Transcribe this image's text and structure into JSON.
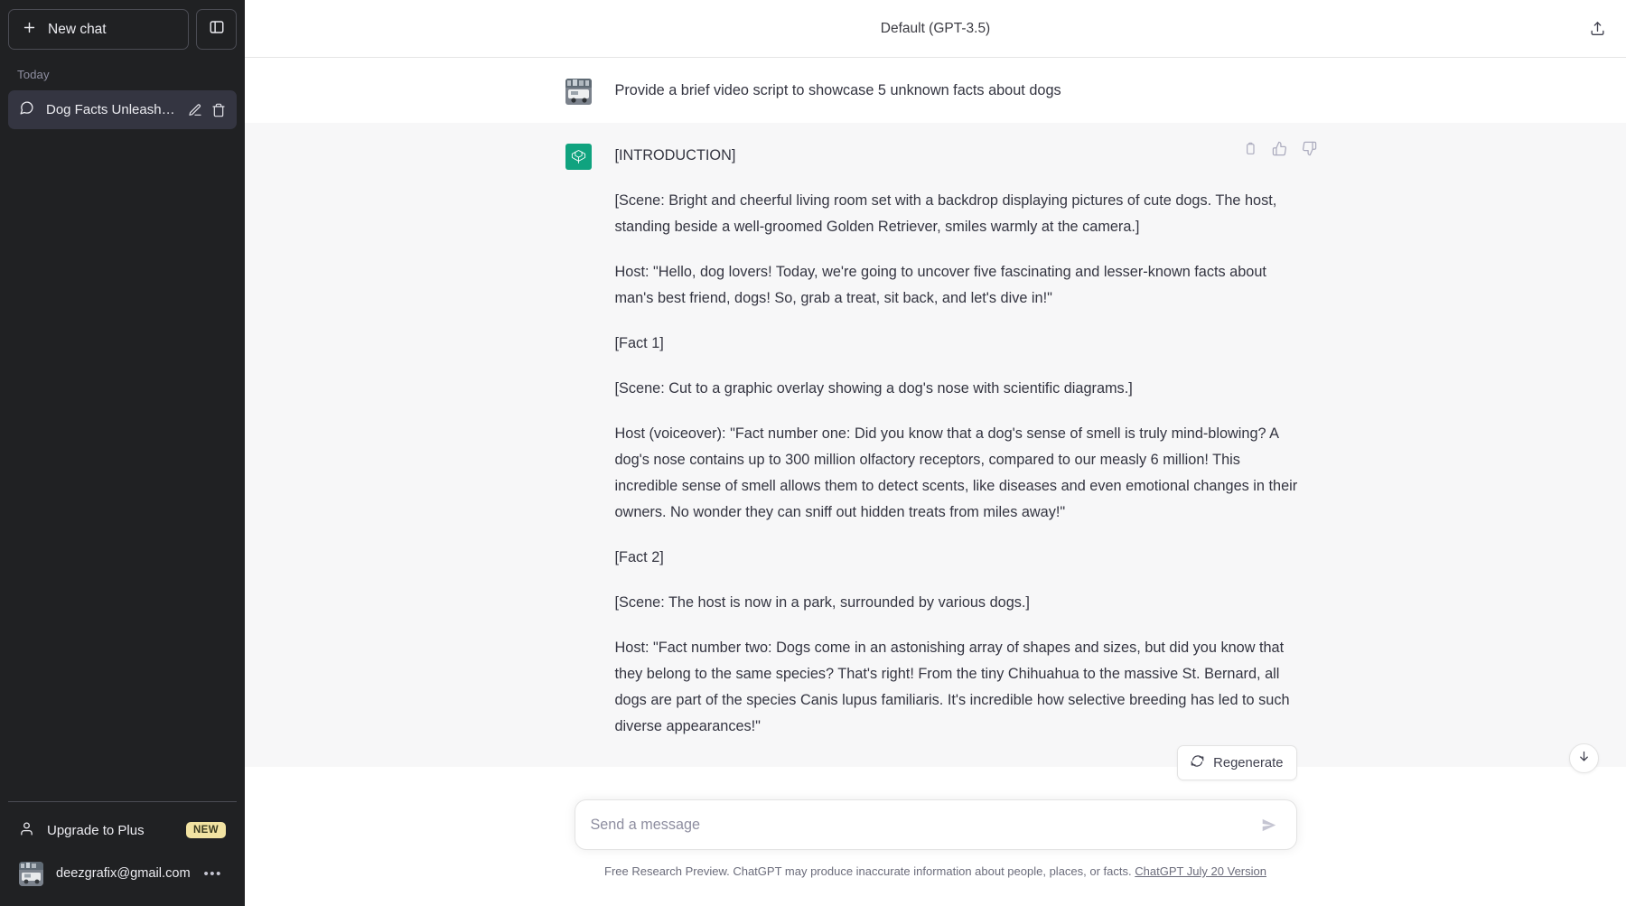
{
  "sidebar": {
    "new_chat_label": "New chat",
    "section_label": "Today",
    "chats": [
      {
        "title": "Dog Facts Unleashed"
      }
    ],
    "upgrade_label": "Upgrade to Plus",
    "upgrade_badge": "NEW",
    "account_email": "deezgrafix@gmail.com",
    "account_menu_dots": "•••",
    "icons": {
      "new_chat": "plus-icon",
      "panel_toggle": "sidebar-toggle-icon",
      "chat": "chat-bubble-icon",
      "edit": "pencil-icon",
      "delete": "trash-icon",
      "person": "person-icon"
    }
  },
  "header": {
    "title": "Default (GPT-3.5)",
    "share_icon": "share-upload-icon"
  },
  "conversation": {
    "user_message": {
      "text": "Provide a brief video script to showcase 5 unknown facts about dogs"
    },
    "assistant_message": {
      "paragraphs": [
        "[INTRODUCTION]",
        "[Scene: Bright and cheerful living room set with a backdrop displaying pictures of cute dogs. The host, standing beside a well-groomed Golden Retriever, smiles warmly at the camera.]",
        "Host: \"Hello, dog lovers! Today, we're going to uncover five fascinating and lesser-known facts about man's best friend, dogs! So, grab a treat, sit back, and let's dive in!\"",
        "[Fact 1]",
        "[Scene: Cut to a graphic overlay showing a dog's nose with scientific diagrams.]",
        "Host (voiceover): \"Fact number one: Did you know that a dog's sense of smell is truly mind-blowing? A dog's nose contains up to 300 million olfactory receptors, compared to our measly 6 million! This incredible sense of smell allows them to detect scents, like diseases and even emotional changes in their owners. No wonder they can sniff out hidden treats from miles away!\"",
        "[Fact 2]",
        "[Scene: The host is now in a park, surrounded by various dogs.]",
        "Host: \"Fact number two: Dogs come in an astonishing array of shapes and sizes, but did you know that they belong to the same species? That's right! From the tiny Chihuahua to the massive St. Bernard, all dogs are part of the species Canis lupus familiaris. It's incredible how selective breeding has led to such diverse appearances!\""
      ],
      "actions": {
        "copy": "copy-icon",
        "thumbs_up": "thumbs-up-icon",
        "thumbs_down": "thumbs-down-icon"
      }
    }
  },
  "composer": {
    "placeholder": "Send a message",
    "value": "",
    "send_icon": "send-arrow-icon",
    "regenerate_label": "Regenerate",
    "regenerate_icon": "refresh-icon",
    "scroll_down_icon": "arrow-down-icon"
  },
  "footer": {
    "text": "Free Research Preview. ChatGPT may produce inaccurate information about people, places, or facts.",
    "link_text": "ChatGPT July 20 Version"
  },
  "colors": {
    "sidebar_bg": "#202123",
    "sidebar_active": "#343541",
    "assistant_bg": "#f7f7f8",
    "brand_green": "#10a37f",
    "badge_yellow": "#f2e3a2",
    "text_primary": "#343541",
    "text_muted": "#8e8ea0"
  }
}
